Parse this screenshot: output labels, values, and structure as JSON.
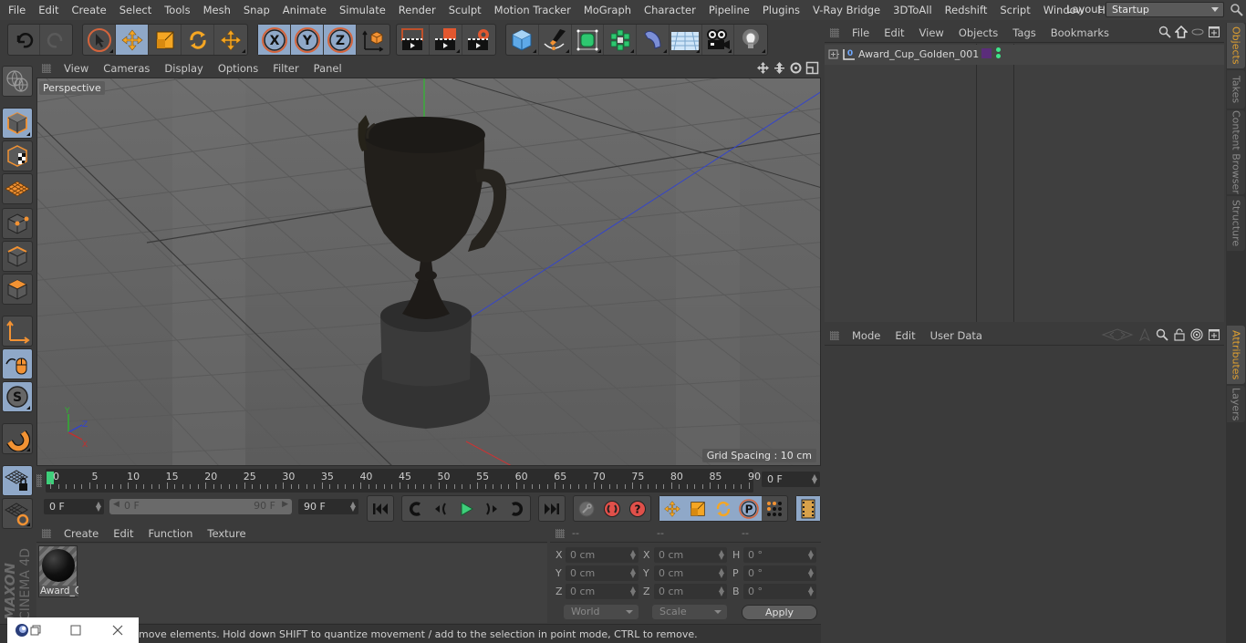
{
  "menubar": {
    "items": [
      "File",
      "Edit",
      "Create",
      "Select",
      "Tools",
      "Mesh",
      "Snap",
      "Animate",
      "Simulate",
      "Render",
      "Sculpt",
      "Motion Tracker",
      "MoGraph",
      "Character",
      "Pipeline",
      "Plugins",
      "V-Ray Bridge",
      "3DToAll",
      "Redshift",
      "Script",
      "Window",
      "Help"
    ],
    "layout_label": "Layout:",
    "layout_value": "Startup"
  },
  "toolbar": {
    "undo": "undo-icon",
    "redo": "redo-icon",
    "tools": [
      "live-selection",
      "move",
      "scale",
      "rotate",
      "last-tool"
    ],
    "axes": [
      "X",
      "Y",
      "Z"
    ],
    "coord_system": "world-coordinate-icon",
    "render": [
      "render-view",
      "render-to-picture-viewer",
      "render-settings"
    ],
    "create": [
      "cube",
      "pen-spline",
      "subdivision-surface",
      "cloner",
      "deformer",
      "floor",
      "camera",
      "light"
    ]
  },
  "viewport": {
    "menu": [
      "View",
      "Cameras",
      "Display",
      "Options",
      "Filter",
      "Panel"
    ],
    "camera_label": "Perspective",
    "grid_spacing": "Grid Spacing : 10 cm",
    "axis_labels": {
      "x": "X",
      "y": "Y",
      "z": "Z"
    },
    "colors": {
      "x_axis": "#c03030",
      "y_axis": "#30b030",
      "z_axis": "#3030c0",
      "background": "#6a6a6a"
    }
  },
  "timeline": {
    "ticks": [
      "0",
      "5",
      "10",
      "15",
      "20",
      "25",
      "30",
      "35",
      "40",
      "45",
      "50",
      "55",
      "60",
      "65",
      "70",
      "75",
      "80",
      "85",
      "90"
    ],
    "current_frame": "0 F",
    "playhead_color": "#3ecf7a"
  },
  "transport": {
    "start_field": "0 F",
    "range_start": "0 F",
    "range_end": "90 F",
    "end_field": "90 F"
  },
  "material_panel": {
    "menu": [
      "Create",
      "Edit",
      "Function",
      "Texture"
    ],
    "materials": [
      {
        "name": "Award_Cup_Golden"
      }
    ]
  },
  "coord_panel": {
    "headers": [
      "--",
      "--",
      "--"
    ],
    "rows": [
      {
        "l1": "X",
        "v1": "0 cm",
        "l2": "X",
        "v2": "0 cm",
        "l3": "H",
        "v3": "0 °"
      },
      {
        "l1": "Y",
        "v1": "0 cm",
        "l2": "Y",
        "v2": "0 cm",
        "l3": "P",
        "v3": "0 °"
      },
      {
        "l1": "Z",
        "v1": "0 cm",
        "l2": "Z",
        "v2": "0 cm",
        "l3": "B",
        "v3": "0 °"
      }
    ],
    "space_dropdown": "World",
    "mode_dropdown": "Scale",
    "apply_label": "Apply"
  },
  "status": {
    "text": "move elements. Hold down SHIFT to quantize movement / add to the selection in point mode, CTRL to remove."
  },
  "brand": {
    "maxon": "MAXON",
    "product": "CINEMA 4D"
  },
  "object_manager": {
    "menu": [
      "File",
      "Edit",
      "View",
      "Objects",
      "Tags",
      "Bookmarks"
    ],
    "objects": [
      {
        "name": "Award_Cup_Golden_001",
        "layer_color": "#5b2d7a"
      }
    ]
  },
  "attribute_manager": {
    "menu": [
      "Mode",
      "Edit",
      "User Data"
    ]
  },
  "right_tabs": {
    "top": [
      {
        "label": "Objects",
        "active": true
      },
      {
        "label": "Takes",
        "active": false
      },
      {
        "label": "Content Browser",
        "active": false
      },
      {
        "label": "Structure",
        "active": false
      }
    ],
    "bottom": [
      {
        "label": "Attributes",
        "active": true
      },
      {
        "label": "Layers",
        "active": false
      }
    ]
  }
}
